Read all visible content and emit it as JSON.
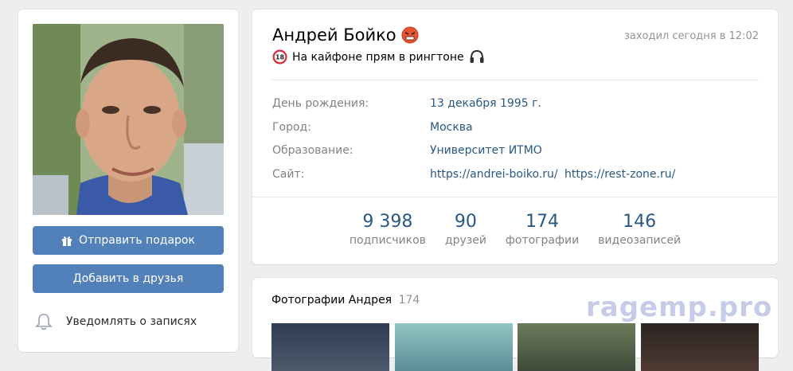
{
  "profile": {
    "name": "Андрей Бойко",
    "last_seen": "заходил сегодня в 12:02",
    "status": "На кайфоне прям в рингтоне",
    "name_emoji": "angry-face-icon",
    "status_emoji_left": "18-plus-icon",
    "status_emoji_right": "headphones-icon"
  },
  "details": {
    "birthday_label": "День рождения:",
    "birthday_value": "13 декабря 1995 г.",
    "city_label": "Город:",
    "city_value": "Москва",
    "education_label": "Образование:",
    "education_value": "Университет ИТМО",
    "site_label": "Сайт:",
    "site_link_1": "https://andrei-boiko.ru/",
    "site_link_2": "https://rest-zone.ru/"
  },
  "counters": [
    {
      "value": "9 398",
      "label": "подписчиков"
    },
    {
      "value": "90",
      "label": "друзей"
    },
    {
      "value": "174",
      "label": "фотографии"
    },
    {
      "value": "146",
      "label": "видеозаписей"
    }
  ],
  "actions": {
    "gift_label": "Отправить подарок",
    "add_friend_label": "Добавить в друзья",
    "notify_label": "Уведомлять о записях"
  },
  "photos": {
    "title": "Фотографии Андрея",
    "count": "174"
  },
  "watermark": "ragemp.pro",
  "colors": {
    "accent": "#5181b8",
    "link": "#2a5885",
    "background": "#edeef0",
    "muted": "#828282"
  }
}
